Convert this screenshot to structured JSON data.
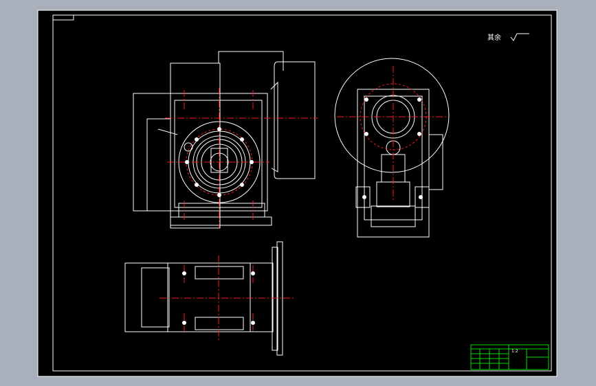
{
  "drawing": {
    "surface_note": "其余",
    "roughness_symbol": "roughness-check-icon",
    "title_block": {
      "drawing_code": "",
      "scale": "1:2"
    },
    "colors": {
      "background": "#000000",
      "outline": "#ffffff",
      "centerline": "#ff1a1a",
      "title_block": "#00e000",
      "canvas": "#a9b0bc"
    }
  }
}
